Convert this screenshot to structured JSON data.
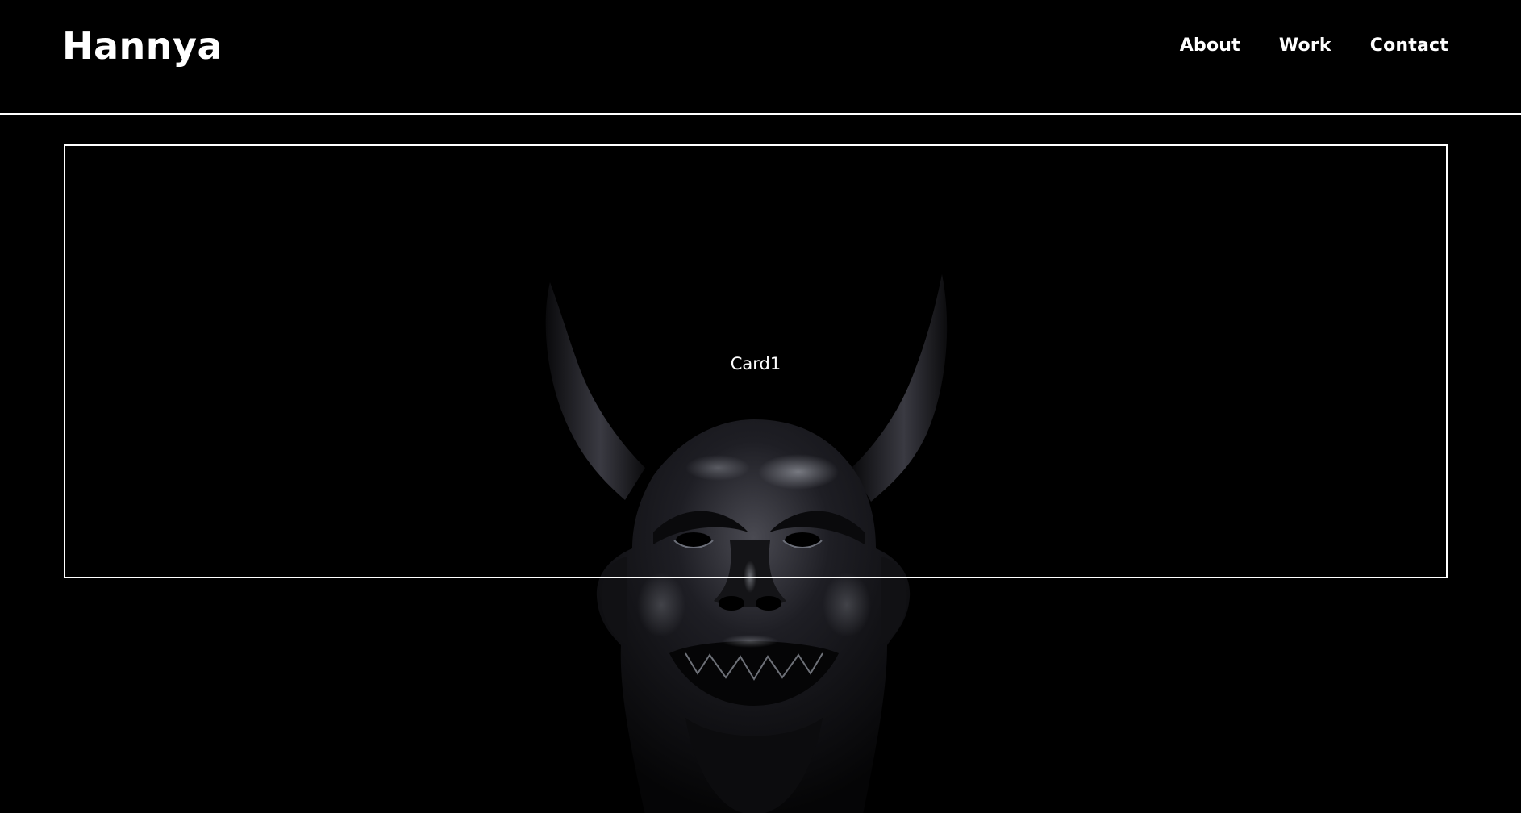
{
  "header": {
    "brand": "Hannya",
    "nav": [
      {
        "label": "About"
      },
      {
        "label": "Work"
      },
      {
        "label": "Contact"
      }
    ]
  },
  "hero": {
    "card_label": "Card1",
    "image": "hannya-mask-3d-render"
  },
  "colors": {
    "background": "#000000",
    "foreground": "#ffffff"
  }
}
